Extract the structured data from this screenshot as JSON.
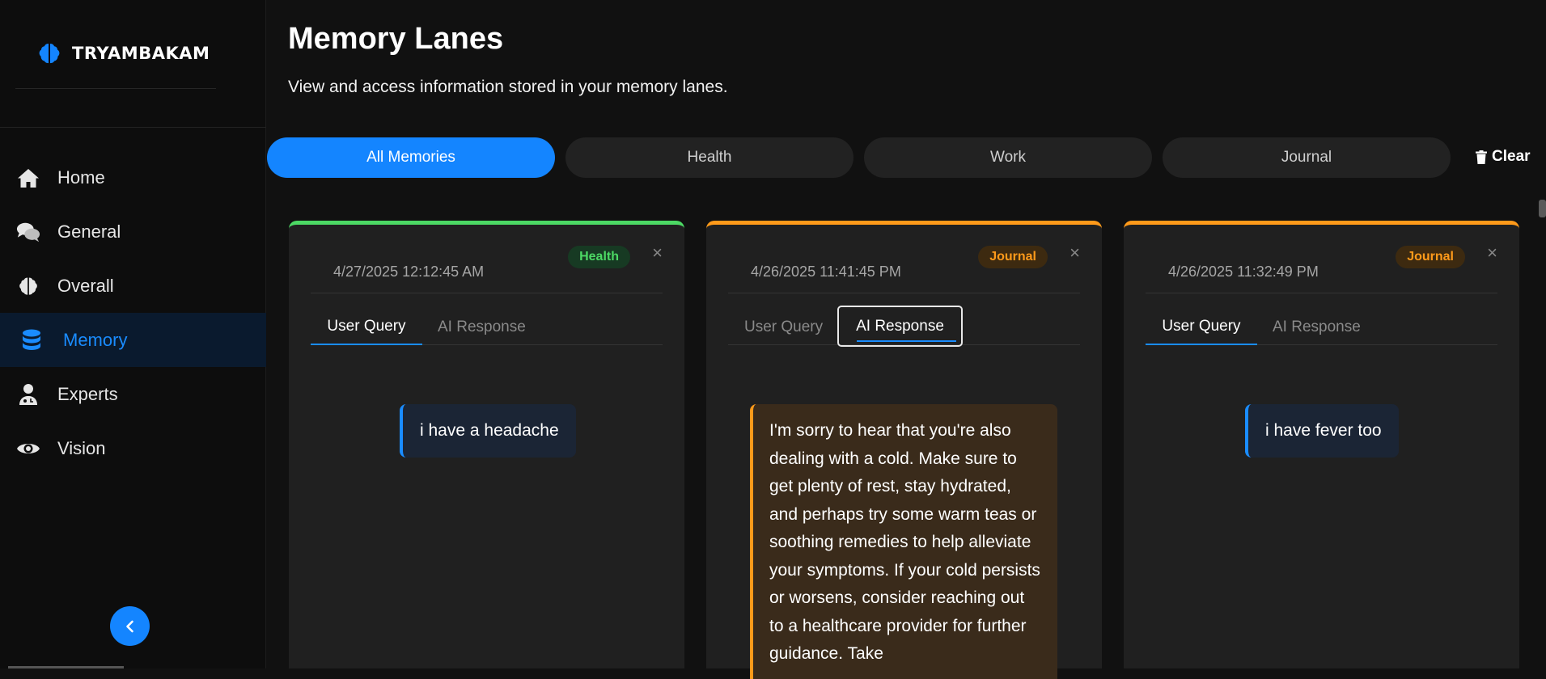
{
  "brand": {
    "name": "TRYAMBAKAM",
    "logo_icon": "brain-icon",
    "color": "#1485ff"
  },
  "sidebar": {
    "items": [
      {
        "label": "Home",
        "icon": "home-icon",
        "active": false
      },
      {
        "label": "General",
        "icon": "chat-bubbles-icon",
        "active": false
      },
      {
        "label": "Overall",
        "icon": "brain-icon",
        "active": false
      },
      {
        "label": "Memory",
        "icon": "database-icon",
        "active": true
      },
      {
        "label": "Experts",
        "icon": "user-doctor-icon",
        "active": false
      },
      {
        "label": "Vision",
        "icon": "eye-icon",
        "active": false
      }
    ],
    "collapse_icon": "chevron-left-icon"
  },
  "header": {
    "title": "Memory Lanes",
    "subtitle": "View and access information stored in your memory lanes."
  },
  "filters": {
    "pills": [
      {
        "label": "All Memories",
        "active": true
      },
      {
        "label": "Health",
        "active": false
      },
      {
        "label": "Work",
        "active": false
      },
      {
        "label": "Journal",
        "active": false
      }
    ],
    "clear_label": "Clear",
    "clear_icon": "trash-icon"
  },
  "cards": [
    {
      "date": "4/27/2025 12:12:45 AM",
      "category": "Health",
      "close": "×",
      "tab_user": "User Query",
      "tab_ai": "AI Response",
      "active_tab": "user",
      "content": "i have a headache"
    },
    {
      "date": "4/26/2025 11:41:45 PM",
      "category": "Journal",
      "close": "×",
      "tab_user": "User Query",
      "tab_ai": "AI Response",
      "active_tab": "ai",
      "content": "I'm sorry to hear that you're also dealing with a cold. Make sure to get plenty of rest, stay hydrated, and perhaps try some warm teas or soothing remedies to help alleviate your symptoms. If your cold persists or worsens, consider reaching out to a healthcare provider for further guidance. Take"
    },
    {
      "date": "4/26/2025 11:32:49 PM",
      "category": "Journal",
      "close": "×",
      "tab_user": "User Query",
      "tab_ai": "AI Response",
      "active_tab": "user",
      "content": "i have fever too"
    }
  ],
  "colors": {
    "accent": "#1485ff",
    "health": "#4cd964",
    "journal": "#ff9a1a",
    "background": "#111111",
    "card": "#202020"
  }
}
